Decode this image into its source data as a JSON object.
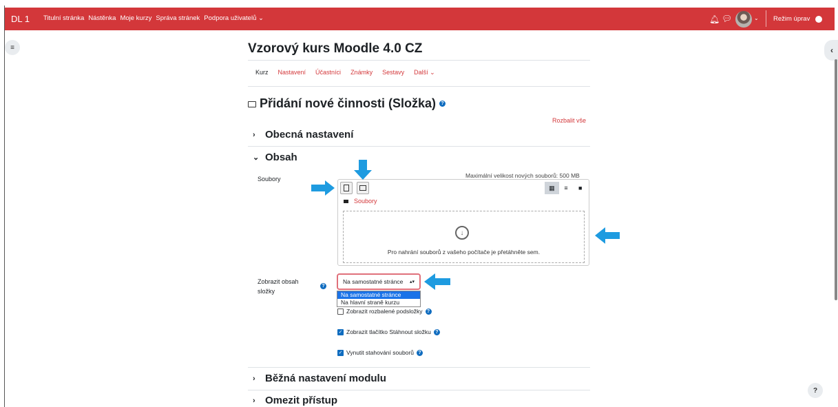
{
  "navbar": {
    "brand": "DL 1",
    "links": [
      "Titulní stránka",
      "Nástěnka",
      "Moje kurzy",
      "Správa stránek",
      "Podpora uživatelů ⌄"
    ],
    "edit_mode": "Režim úprav",
    "accent": "#d3373a"
  },
  "course": {
    "title": "Vzorový kurs Moodle 4.0 CZ",
    "tabs": [
      "Kurz",
      "Nastavení",
      "Účastníci",
      "Známky",
      "Sestavy",
      "Další ⌄"
    ]
  },
  "page": {
    "heading": "Přidání nové činnosti (Složka)",
    "expand_all": "Rozbalit vše"
  },
  "sections": {
    "general": "Obecná nastavení",
    "content": "Obsah",
    "common": "Běžná nastavení modulu",
    "restrict": "Omezit přístup"
  },
  "files": {
    "label": "Soubory",
    "max_size": "Maximální velikost nových souborů: 500 MB",
    "path_label": "Soubory",
    "drop_text": "Pro nahrání souborů z vašeho počítače je přetáhněte sem."
  },
  "display": {
    "label_line1": "Zobrazit obsah",
    "label_line2": "složky",
    "selected": "Na samostatné stránce",
    "options": [
      "Na samostatné stránce",
      "Na hlavní straně kurzu"
    ]
  },
  "checkboxes": [
    {
      "label": "Zobrazit rozbalené podsložky",
      "checked": false
    },
    {
      "label": "Zobrazit tlačítko Stáhnout složku",
      "checked": true
    },
    {
      "label": "Vynutit stahování souborů",
      "checked": true
    }
  ],
  "icons": {
    "bell": "bell-icon",
    "chat": "chat-icon",
    "arrow_color": "#1e9be0"
  }
}
